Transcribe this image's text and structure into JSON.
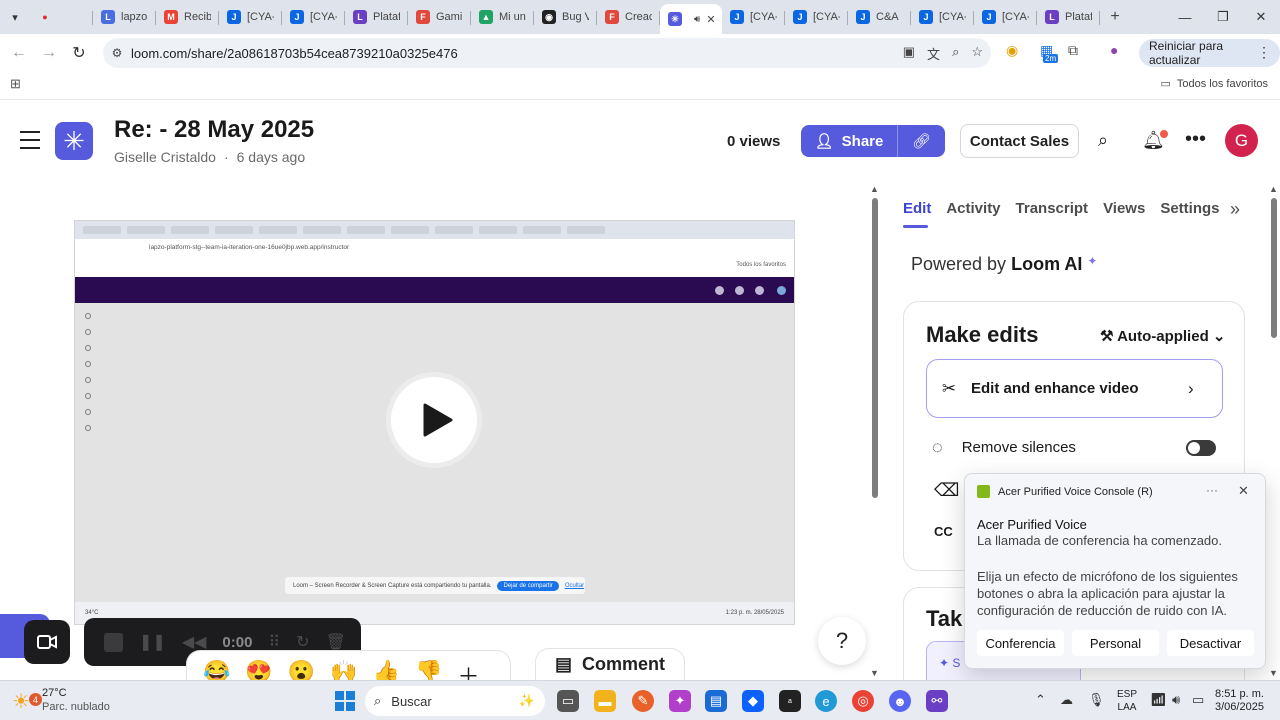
{
  "browser": {
    "tabs": [
      {
        "label": "",
        "color": "#d93025",
        "glyph": "●"
      },
      {
        "label": "lapzo",
        "color": "#4a6ee0",
        "glyph": "L"
      },
      {
        "label": "Recib",
        "color": "#ea4335",
        "glyph": "M"
      },
      {
        "label": "[CYA-",
        "color": "#0b66e4",
        "glyph": "J"
      },
      {
        "label": "[CYA-",
        "color": "#0b66e4",
        "glyph": "J"
      },
      {
        "label": "Plataf",
        "color": "#6b3fc4",
        "glyph": "L"
      },
      {
        "label": "Gami",
        "color": "#e0483e",
        "glyph": "F"
      },
      {
        "label": "Mi un",
        "color": "#1fa463",
        "glyph": "▲"
      },
      {
        "label": "Bug V",
        "color": "#222222",
        "glyph": "◉"
      },
      {
        "label": "Creac",
        "color": "#e0483e",
        "glyph": "F"
      },
      {
        "label": "",
        "color": "#565ADD",
        "glyph": "✳",
        "active": true
      },
      {
        "label": "[CYA-",
        "color": "#0b66e4",
        "glyph": "J"
      },
      {
        "label": "[CYA-",
        "color": "#0b66e4",
        "glyph": "J"
      },
      {
        "label": "C&A",
        "color": "#0b66e4",
        "glyph": "J"
      },
      {
        "label": "[CYA-",
        "color": "#0b66e4",
        "glyph": "J"
      },
      {
        "label": "[CYA-",
        "color": "#0b66e4",
        "glyph": "J"
      },
      {
        "label": "Plataf",
        "color": "#6b3fc4",
        "glyph": "L"
      }
    ],
    "url": "loom.com/share/2a08618703b54cea8739210a0325e476",
    "update_button": "Reiniciar para actualizar",
    "all_bookmarks": "Todos los favoritos",
    "extension_badge": "2m"
  },
  "loom": {
    "title": "Re: - 28 May 2025",
    "author": "Giselle Cristaldo",
    "separator": "·",
    "posted": "6 days ago",
    "views": "0 views",
    "share_label": "Share",
    "contact_label": "Contact Sales",
    "avatar_initial": "G",
    "brand_color": "#565ADD"
  },
  "video": {
    "inner_url": "lapzo-platform-stg--team-ia-iteration-one-16ue0jbp.web.app/instructor",
    "inner_bookmarks": "Todos los favoritos",
    "inner_banner": "Loom – Screen Recorder & Screen Capture está compartiendo tu pantalla.",
    "inner_banner_stop": "Dejar de compartir",
    "inner_banner_hide": "Ocultar",
    "inner_weather": "34°C",
    "inner_time": "1:23 p. m.",
    "inner_date": "28/05/2025",
    "recorder_time": "0:00",
    "reactions": [
      "😂",
      "😍",
      "😮",
      "🙌",
      "👍",
      "👎",
      "＋"
    ],
    "comment_label": "Comment",
    "help_label": "?"
  },
  "panel": {
    "tabs": [
      "Edit",
      "Activity",
      "Transcript",
      "Views",
      "Settings"
    ],
    "powered_prefix": "Powered by",
    "powered_brand": "Loom AI",
    "make_edits": "Make edits",
    "auto_applied": "Auto-applied",
    "enhance_label": "Edit and enhance video",
    "remove_silences": "Remove silences",
    "take_title": "Tak",
    "take_chip": "S"
  },
  "toast": {
    "app_name": "Acer Purified Voice Console (R)",
    "title": "Acer Purified Voice",
    "line": "La llamada de conferencia ha comenzado.",
    "body": "Elija un efecto de micrófono de los siguientes botones o abra la aplicación para ajustar la configuración de reducción de ruido con IA.",
    "buttons": [
      "Conferencia",
      "Personal",
      "Desactivar"
    ]
  },
  "taskbar": {
    "temperature": "27°C",
    "weather": "Parc. nublado",
    "weather_badge": "4",
    "search_placeholder": "Buscar",
    "lang_top": "ESP",
    "lang_bottom": "LAA",
    "time": "8:51 p. m.",
    "date": "3/06/2025"
  }
}
